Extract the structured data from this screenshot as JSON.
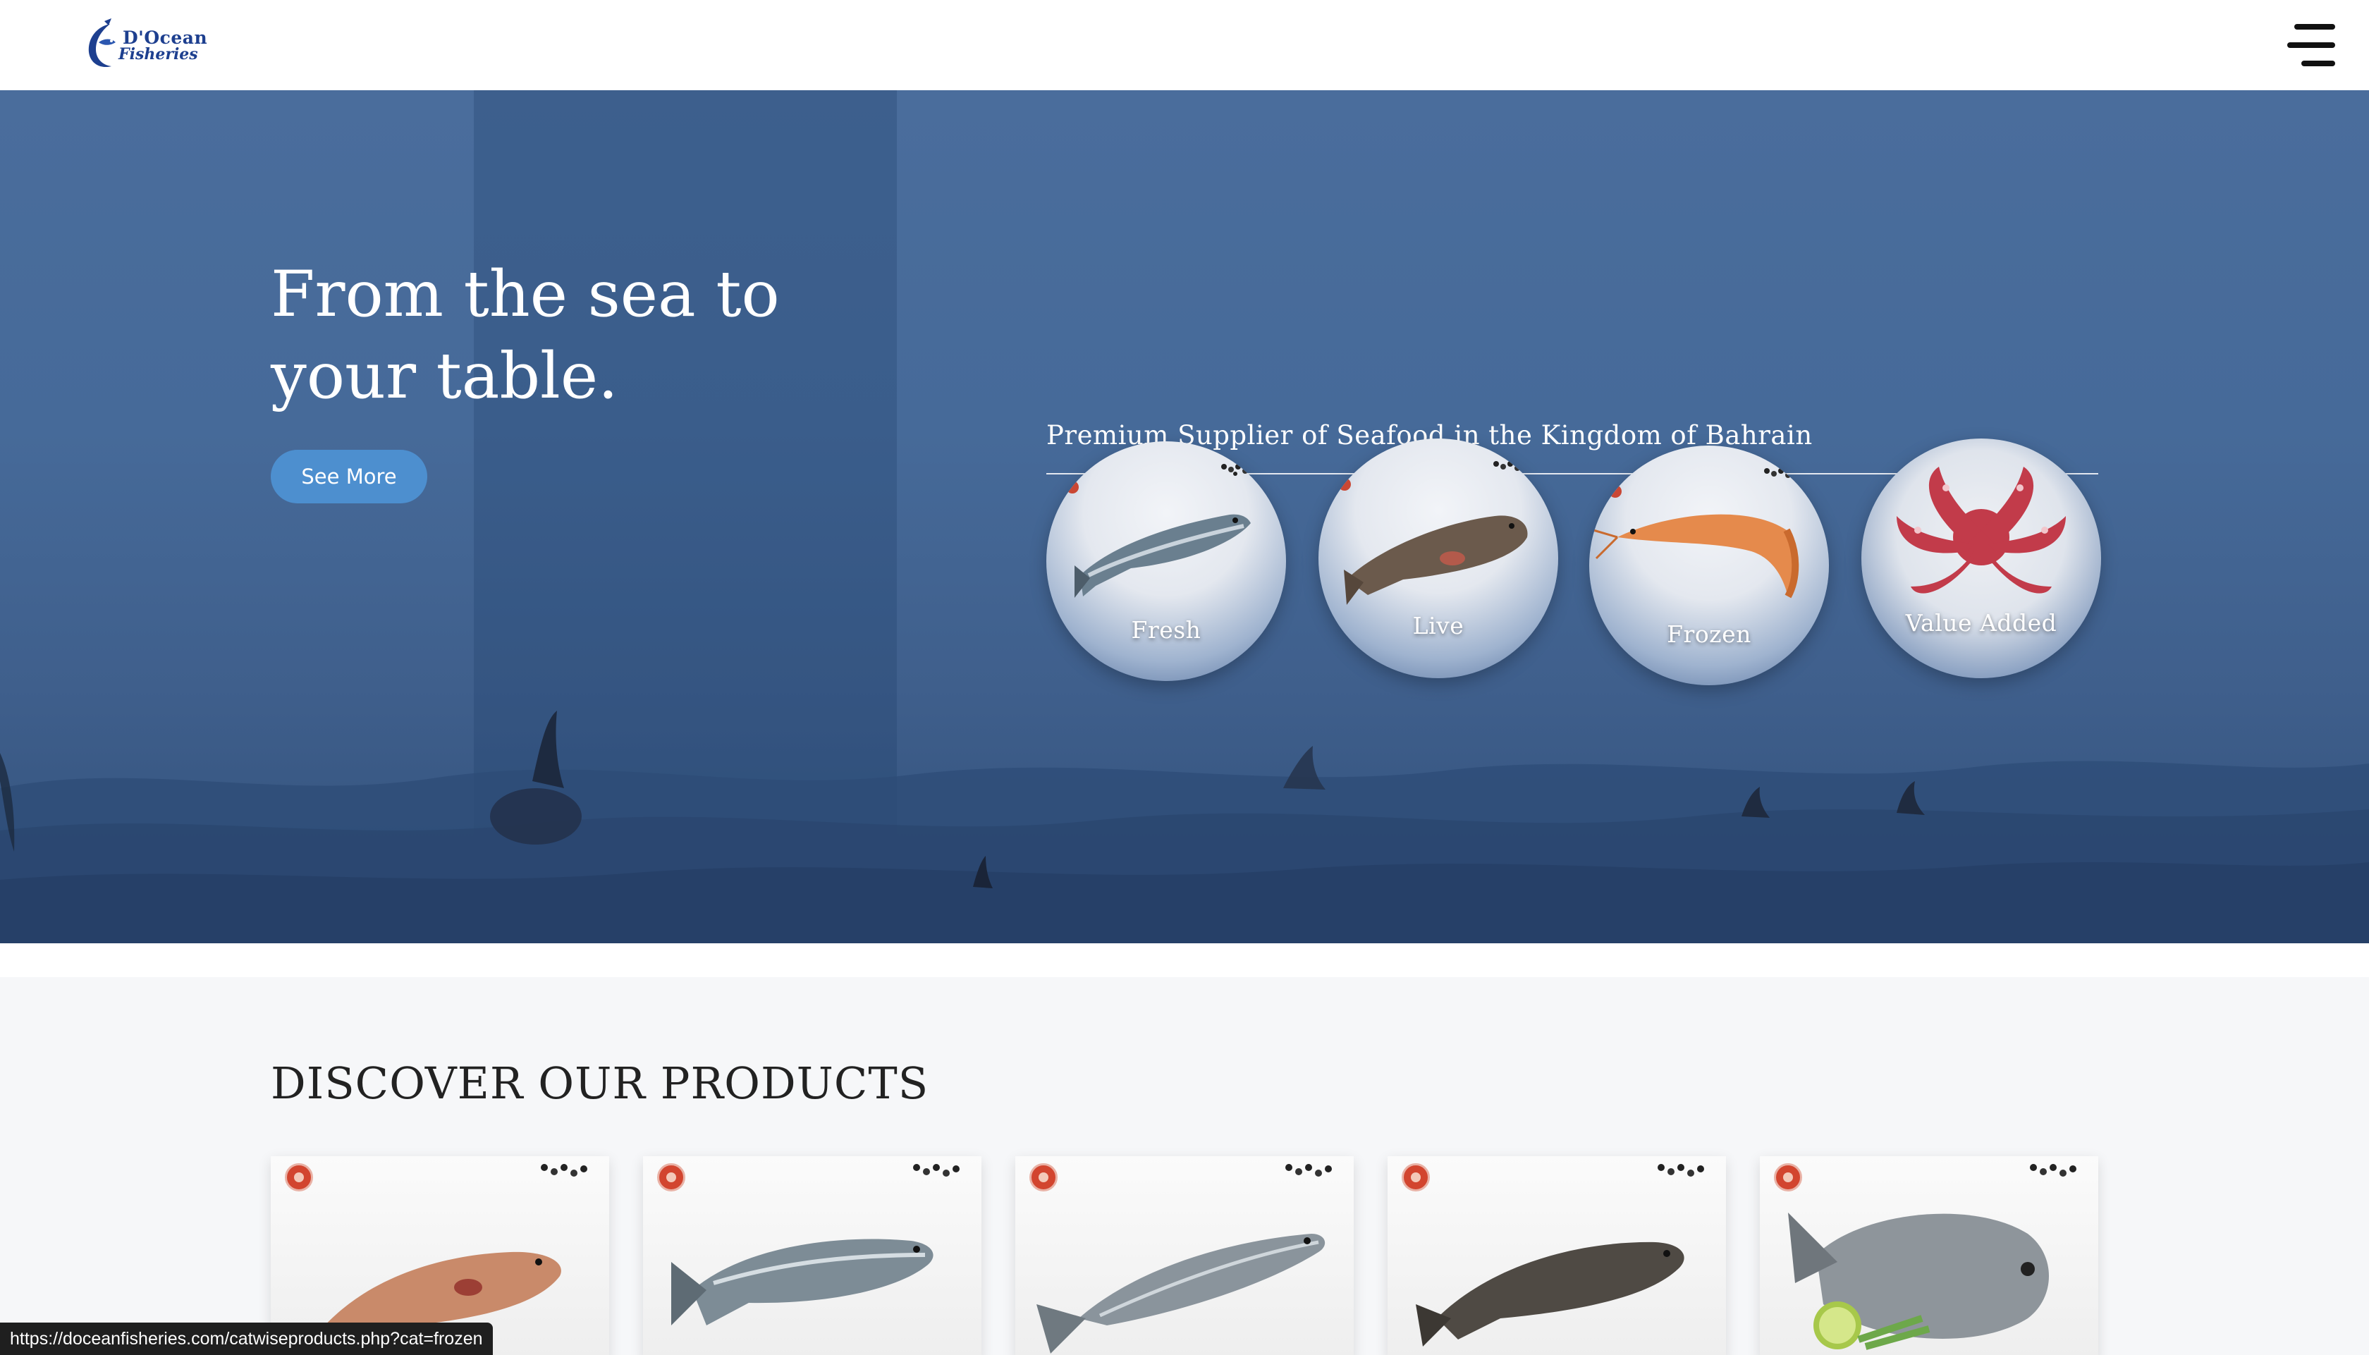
{
  "header": {
    "logo_line1": "D'Ocean",
    "logo_line2": "Fisheries",
    "menu_icon": "hamburger-menu-icon"
  },
  "hero": {
    "title": "From the sea to your table.",
    "cta_label": "See More",
    "tagline": "Premium Supplier of Seafood in the Kingdom of Bahrain",
    "categories": [
      {
        "label": "Fresh",
        "icon": "salmon-icon"
      },
      {
        "label": "Live",
        "icon": "grouper-icon"
      },
      {
        "label": "Frozen",
        "icon": "shrimp-icon"
      },
      {
        "label": "Value Added",
        "icon": "octopus-icon"
      }
    ]
  },
  "products": {
    "heading": "DISCOVER OUR PRODUCTS",
    "cards": [
      {
        "icon": "red-grouper-icon"
      },
      {
        "icon": "sea-bass-icon"
      },
      {
        "icon": "kingfish-icon"
      },
      {
        "icon": "grouper-icon"
      },
      {
        "icon": "sea-bream-icon"
      }
    ]
  },
  "status_bar": {
    "url": "https://doceanfisheries.com/catwiseproducts.php?cat=frozen"
  },
  "colors": {
    "accent": "#4d8fcf",
    "brand": "#1d3f8f",
    "hero_bg": "#466a99"
  }
}
